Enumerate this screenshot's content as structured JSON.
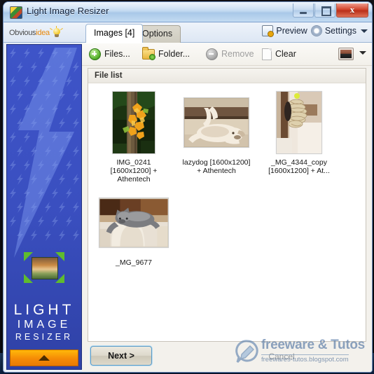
{
  "window": {
    "title": "Light Image Resizer",
    "app_icon": "app-image-icon",
    "controls": {
      "minimize": "minimize-icon",
      "maximize": "maximize-icon",
      "close_label": "x"
    }
  },
  "brand": {
    "part1": "Obvious",
    "part2": "idea",
    "bulb_icon": "lightbulb-icon"
  },
  "tabs": [
    {
      "label": "Images [4]",
      "active": true
    },
    {
      "label": "Options",
      "active": false
    }
  ],
  "header_actions": {
    "preview_label": "Preview",
    "preview_icon": "preview-icon",
    "settings_label": "Settings",
    "settings_icon": "gear-icon",
    "settings_caret": "chevron-down-icon"
  },
  "toolbar": {
    "files_label": "Files...",
    "files_icon": "add-circle-icon",
    "folder_label": "Folder...",
    "folder_icon": "add-folder-icon",
    "remove_label": "Remove",
    "remove_icon": "remove-circle-icon",
    "remove_disabled": true,
    "clear_label": "Clear",
    "clear_icon": "blank-page-icon",
    "view_mode_icon": "thumbnail-view-icon",
    "view_mode_caret": "chevron-down-icon"
  },
  "file_list": {
    "header": "File list",
    "count": 4,
    "items": [
      {
        "caption": "IMG_0241 [1600x1200] + Athentech",
        "thumb": "autumn-leaves-on-tree",
        "orientation": "portrait"
      },
      {
        "caption": "lazydog [1600x1200] + Athentech",
        "thumb": "sepia-dog-lying-on-back",
        "orientation": "landscape"
      },
      {
        "caption": "_MG_4344_copy [1600x1200] + At...",
        "thumb": "coiled-rope-closeup",
        "orientation": "portrait"
      },
      {
        "caption": "_MG_9677",
        "thumb": "grey-cat-on-cushion",
        "orientation": "landscape"
      }
    ]
  },
  "footer": {
    "next_label": "Next >",
    "cancel_label": "Cancel"
  },
  "sidebar": {
    "logo_icon": "resize-arrows-image-icon",
    "title_line1": "LIGHT",
    "title_line2": "IMAGE",
    "title_line3": "RESIZER",
    "collapse_icon": "chevron-up-icon",
    "background_pattern": "lightning-bolt-pattern"
  },
  "watermark": {
    "icon": "speech-bubble-pencil-icon",
    "title": "freeware & Tutos",
    "url": "freewares-tutos.blogspot.com"
  },
  "colors": {
    "accent_blue": "#3e54c8",
    "accent_orange": "#f58b06",
    "brand_orange": "#e8890c",
    "titlebar_blue": "#bcd5ef",
    "close_red": "#d2442c"
  }
}
